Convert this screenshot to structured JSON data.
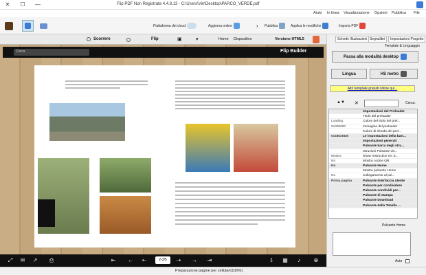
{
  "window": {
    "title": "Flip PDF Non Registrata 4.4.8.13 - C:\\Users\\Vin\\Desktop\\PARCO_VERDE.pdf"
  },
  "menus": [
    "File",
    "Pubblica",
    "Opzioni",
    "Visualizzazione",
    "In linea",
    "Aiuto"
  ],
  "toolbar": {
    "import_pdf": "Importa PDF",
    "apply_changes": "Applica le modifiche",
    "publish": "Pubblica",
    "publish_online": "Aggiorna online",
    "cloud": "Piattaforma dei cloud"
  },
  "ribbon": {
    "html5": "Versione HTML5",
    "device": "Dispositivo",
    "home": "Home",
    "flip": "Flip",
    "scroll": "Scorrere"
  },
  "viewer": {
    "brand": "Flip Builder",
    "search_placeholder": "Cerca",
    "page_number": "2-3/5",
    "status": "Preparazione pagine per cellulari(100%)"
  },
  "right_panel": {
    "tabs": [
      "Impostazioni Progetto",
      "Segnalibri",
      "Schede Illustrazioni"
    ],
    "template_label": "Template & Linguaggio",
    "change_template": "Passa alla modalità desktop",
    "theme": "HS metro",
    "language": "Lingua",
    "more_templates": "Altri template gratuiti online qui...",
    "search_label": "Cerca:",
    "properties": [
      {
        "key": "Impostazioni del Preloader",
        "value": "",
        "group": true
      },
      {
        "key": "Titolo del preloader",
        "value": "",
        "group": false
      },
      {
        "key": "Colore del titolo del prel...",
        "value": "Loading",
        "group": false
      },
      {
        "key": "Immagine del preloader",
        "value": "0x000000",
        "group": false
      },
      {
        "key": "Colore di sfondo del prel...",
        "value": "",
        "group": false
      },
      {
        "key": "Le impostazioni della barr...",
        "value": "0xDEDEDE",
        "group": true
      },
      {
        "key": "Impostazioni generali",
        "value": "",
        "group": true
      },
      {
        "key": "Pulsante barra degli stru...",
        "value": "",
        "group": true
      },
      {
        "key": "Istruzioni Pulsante vis...",
        "value": "",
        "group": false
      },
      {
        "key": "Show Instruction On S...",
        "value": "Mostra",
        "group": false
      },
      {
        "key": "Mostra codice QR",
        "value": "No",
        "group": false
      },
      {
        "key": "Pulsante Home",
        "value": "No",
        "group": true
      },
      {
        "key": "Mostra pulsante Home",
        "value": "",
        "group": false
      },
      {
        "key": "Collegamento al pul...",
        "value": "No",
        "group": false
      },
      {
        "key": "Pulsante Interfaccia utente",
        "value": "Prima pagina",
        "group": true
      },
      {
        "key": "Pulsante per condividere",
        "value": "",
        "group": true
      },
      {
        "key": "Pulsante condividi per...",
        "value": "",
        "group": true
      },
      {
        "key": "Pulsante di stampa",
        "value": "",
        "group": true
      },
      {
        "key": "Pulsante Download",
        "value": "",
        "group": true
      },
      {
        "key": "Pulsante della Tabella ...",
        "value": "",
        "group": true
      }
    ],
    "description_label": "Pulsante Home",
    "auto_label": "Auto"
  }
}
